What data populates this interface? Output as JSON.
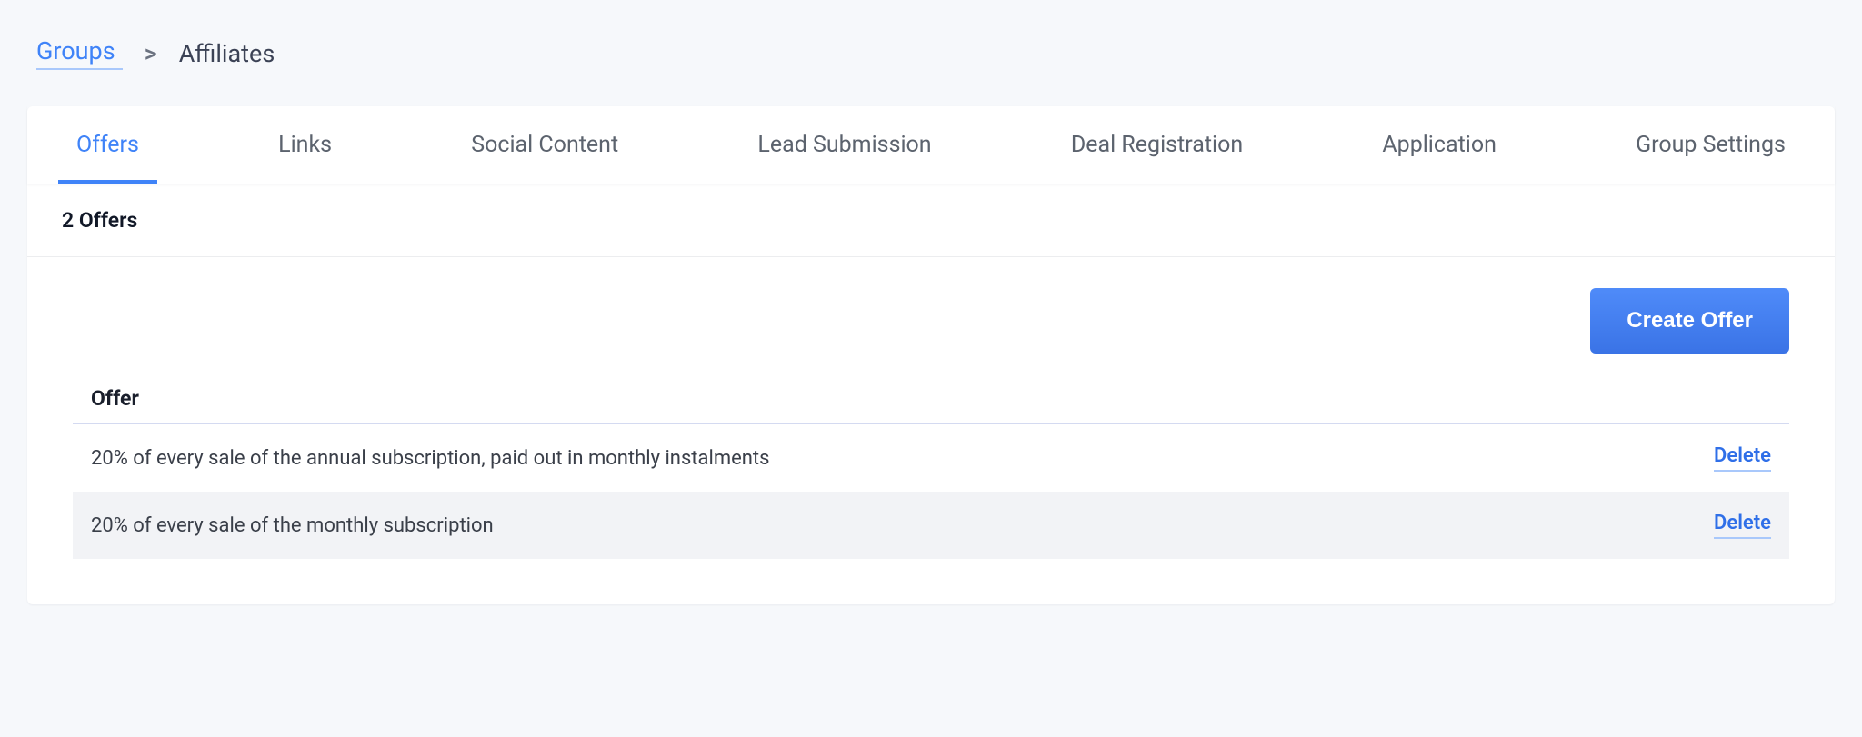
{
  "breadcrumb": {
    "root": "Groups",
    "separator": ">",
    "current": "Affiliates"
  },
  "tabs": [
    {
      "label": "Offers",
      "active": true
    },
    {
      "label": "Links",
      "active": false
    },
    {
      "label": "Social Content",
      "active": false
    },
    {
      "label": "Lead Submission",
      "active": false
    },
    {
      "label": "Deal Registration",
      "active": false
    },
    {
      "label": "Application",
      "active": false
    },
    {
      "label": "Group Settings",
      "active": false
    }
  ],
  "count_label": "2 Offers",
  "create_button": "Create Offer",
  "table": {
    "header": "Offer",
    "delete_label": "Delete",
    "rows": [
      {
        "text": "20% of every sale of the annual subscription, paid out in monthly instalments"
      },
      {
        "text": "20% of every sale of the monthly subscription"
      }
    ]
  }
}
